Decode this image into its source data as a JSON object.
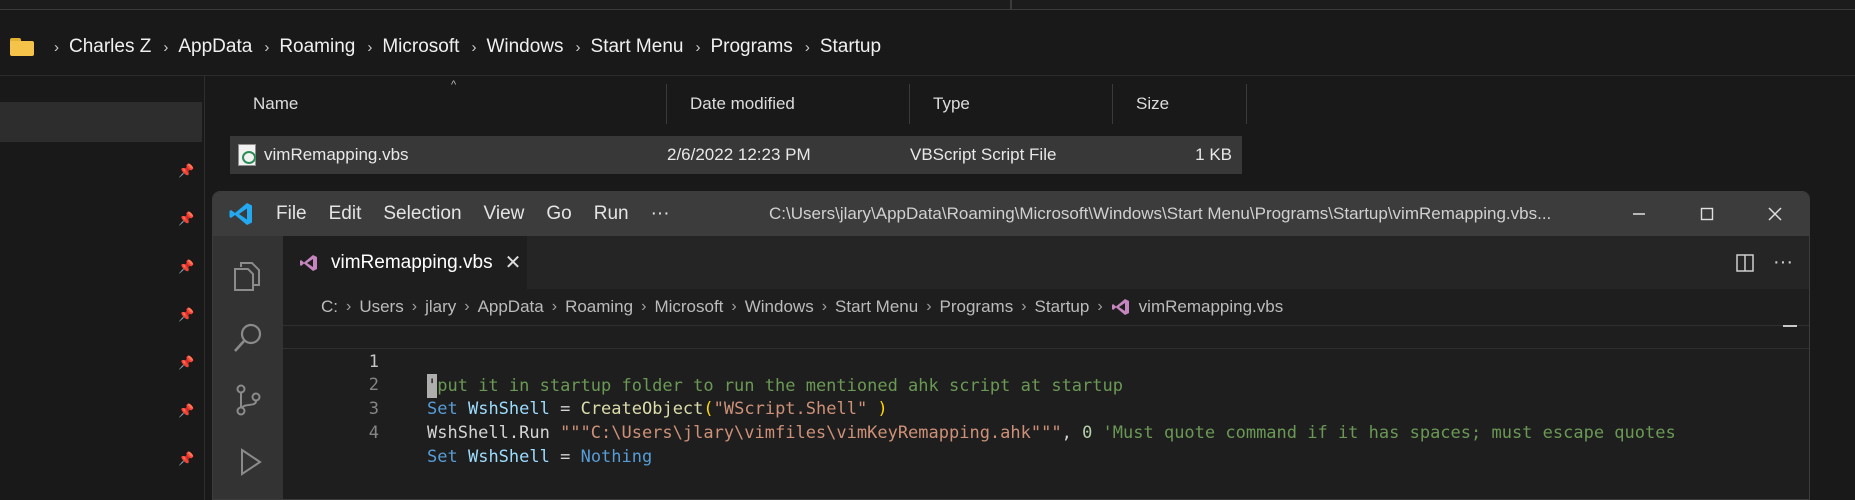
{
  "explorer": {
    "breadcrumb": [
      "Charles Z",
      "AppData",
      "Roaming",
      "Microsoft",
      "Windows",
      "Start Menu",
      "Programs",
      "Startup"
    ],
    "columns": [
      "Name",
      "Date modified",
      "Type",
      "Size"
    ],
    "files": [
      {
        "name": "vimRemapping.vbs",
        "date_modified": "2/6/2022 12:23 PM",
        "type": "VBScript Script File",
        "size": "1 KB"
      }
    ],
    "pin_icon": "pin-icon"
  },
  "vscode": {
    "menu": [
      "File",
      "Edit",
      "Selection",
      "View",
      "Go",
      "Run",
      "···"
    ],
    "window_title": "C:\\Users\\jlary\\AppData\\Roaming\\Microsoft\\Windows\\Start Menu\\Programs\\Startup\\vimRemapping.vbs...",
    "tab": {
      "label": "vimRemapping.vbs",
      "close": "✕"
    },
    "breadcrumbs": [
      "C:",
      "Users",
      "jlary",
      "AppData",
      "Roaming",
      "Microsoft",
      "Windows",
      "Start Menu",
      "Programs",
      "Startup",
      "vimRemapping.vbs"
    ],
    "line_numbers": [
      "1",
      "2",
      "3",
      "4"
    ],
    "code": {
      "l1": {
        "cursor": "'",
        "comment": "put it in startup folder to run the mentioned ahk script at startup"
      },
      "l2": {
        "kw": "Set",
        "var": "WshShell",
        "eq": " = ",
        "fn": "CreateObject",
        "open": "(",
        "str": "\"WScript.Shell\"",
        "close": " )"
      },
      "l3": {
        "obj": "WshShell.Run ",
        "str": "\"\"\"C:\\Users\\jlary\\vimfiles\\vimKeyRemapping.ahk\"\"\"",
        "comma": ", ",
        "num": "0",
        "comment": " 'Must quote command if it has spaces; must escape quotes"
      },
      "l4": {
        "kw": "Set",
        "var": "WshShell",
        "eq": " = ",
        "kw2": "Nothing"
      }
    },
    "colors": {
      "accent_logo": "#23a9f2",
      "file_icon": "#c586c0"
    }
  }
}
